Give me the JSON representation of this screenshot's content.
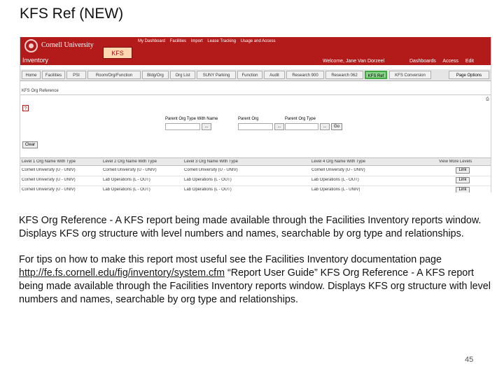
{
  "slide": {
    "title": "KFS Ref (NEW)",
    "page_number": "45"
  },
  "app": {
    "university": "Cornell University",
    "module": "KFS",
    "section": "Inventory",
    "top_links": [
      "My Dashboard",
      "Facilities",
      "Import",
      "Lease Tracking",
      "Usage and Access"
    ],
    "welcome": "Welcome, Jane Van Dorzeel",
    "right_links": [
      "Dashboards",
      "Access",
      "Edit"
    ],
    "tabs": [
      "Home",
      "Facilities",
      "PSI",
      "Room/Org/Function",
      "Bldg/Org",
      "Org List",
      "SUNY Parking",
      "Function",
      "Audit",
      "Research 900",
      "Research 062",
      "KFS Ref",
      "KFS Conversion"
    ],
    "active_tab": "KFS Ref",
    "page_options": "Page Options",
    "subheader": "KFS Org Reference",
    "help_icon": "?"
  },
  "filters": {
    "fields": [
      {
        "label": "Parent Org Type With Name",
        "value": ""
      },
      {
        "label": "Parent Org",
        "value": ""
      },
      {
        "label": "Parent Org Type",
        "value": ""
      }
    ],
    "lookup_label": "...",
    "go_label": "Go",
    "clear_label": "Clear"
  },
  "table": {
    "columns": [
      "Level 1 Org Name With Type",
      "Level 2 Org Name With Type",
      "Level 3 Org Name With Type",
      "Level 4 Org Name With Type",
      "View More Levels"
    ],
    "rows": [
      [
        "Cornell University (U - UNIV)",
        "Cornell University (U - UNIV)",
        "Cornell University (U - UNIV)",
        "Cornell University (U - UNIV)",
        "Link"
      ],
      [
        "Cornell University (U - UNIV)",
        "Lab Operations (L - OUT)",
        "Lab Operations (L - OUT)",
        "Lab Operations (L - OUT)",
        "Link"
      ],
      [
        "Cornell University (U - UNIV)",
        "Lab Operations (L - OUT)",
        "Lab Operations (L - OUT)",
        "Lab Operations (L - UNIV)",
        "Link"
      ]
    ]
  },
  "description": {
    "para1": "KFS Org Reference - A KFS report being made available through the Facilities Inventory reports window. Displays KFS org structure with level numbers and names, searchable by org type and relationships.",
    "para2_prefix": "For tips on how to make this report most useful see the Facilities Inventory documentation page ",
    "link_text": "http://fe.fs.cornell.edu/fig/inventory/system.cfm",
    "para2_suffix": " “Report User Guide” KFS Org Reference - A KFS report being made available through the Facilities Inventory reports window. Displays KFS org structure with level numbers and names, searchable by org type and relationships."
  }
}
